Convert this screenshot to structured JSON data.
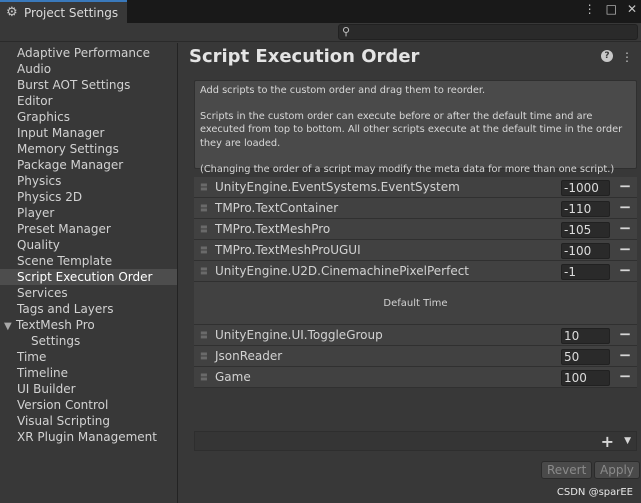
{
  "window": {
    "tab_title": "Project Settings",
    "tab_icon": "gear-icon"
  },
  "search": {
    "placeholder": "",
    "icon": "search-icon"
  },
  "sidebar": {
    "items": [
      {
        "label": "Adaptive Performance"
      },
      {
        "label": "Audio"
      },
      {
        "label": "Burst AOT Settings"
      },
      {
        "label": "Editor"
      },
      {
        "label": "Graphics"
      },
      {
        "label": "Input Manager"
      },
      {
        "label": "Memory Settings"
      },
      {
        "label": "Package Manager"
      },
      {
        "label": "Physics"
      },
      {
        "label": "Physics 2D"
      },
      {
        "label": "Player"
      },
      {
        "label": "Preset Manager"
      },
      {
        "label": "Quality"
      },
      {
        "label": "Scene Template"
      },
      {
        "label": "Script Execution Order"
      },
      {
        "label": "Services"
      },
      {
        "label": "Tags and Layers"
      },
      {
        "label": "TextMesh Pro"
      },
      {
        "label": "Settings"
      },
      {
        "label": "Time"
      },
      {
        "label": "Timeline"
      },
      {
        "label": "UI Builder"
      },
      {
        "label": "Version Control"
      },
      {
        "label": "Visual Scripting"
      },
      {
        "label": "XR Plugin Management"
      }
    ]
  },
  "main": {
    "title": "Script Execution Order",
    "info": {
      "line1": "Add scripts to the custom order and drag them to reorder.",
      "line2": "Scripts in the custom order can execute before or after the default time and are executed from top to bottom. All other scripts execute at the default time in the order they are loaded.",
      "line3": "(Changing the order of a script may modify the meta data for more than one script.)"
    },
    "before_rows": [
      {
        "name": "UnityEngine.EventSystems.EventSystem",
        "order": "-1000"
      },
      {
        "name": "TMPro.TextContainer",
        "order": "-110"
      },
      {
        "name": "TMPro.TextMeshPro",
        "order": "-105"
      },
      {
        "name": "TMPro.TextMeshProUGUI",
        "order": "-100"
      },
      {
        "name": "UnityEngine.U2D.CinemachinePixelPerfect",
        "order": "-1"
      }
    ],
    "default_time_label": "Default Time",
    "after_rows": [
      {
        "name": "UnityEngine.UI.ToggleGroup",
        "order": "10"
      },
      {
        "name": "JsonReader",
        "order": "50"
      },
      {
        "name": "Game",
        "order": "100"
      }
    ],
    "remove_label": "−",
    "add_label": "+",
    "revert_label": "Revert",
    "apply_label": "Apply"
  },
  "watermark": "CSDN @sparEE"
}
